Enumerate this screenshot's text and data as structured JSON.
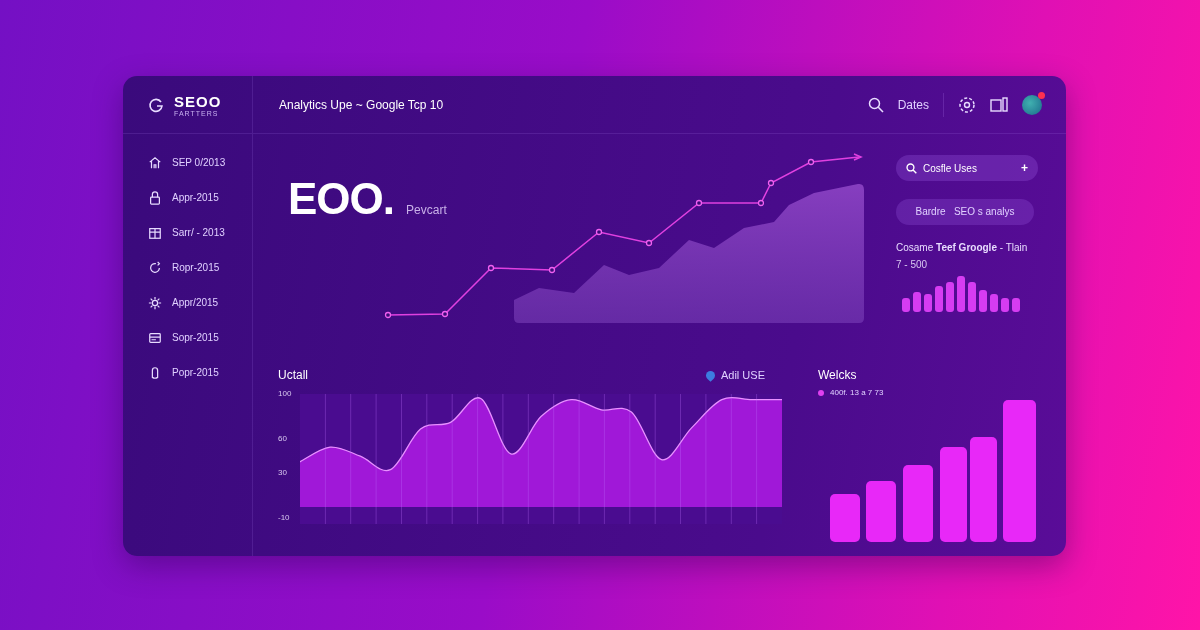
{
  "brand": {
    "name": "SEOO",
    "tagline": "FARTTERS"
  },
  "header": {
    "title": "Analytics Upe ~ Google Tcp 10",
    "dates_label": "Dates",
    "notification": true
  },
  "sidebar": {
    "items": [
      {
        "label": "SEP 0/2013"
      },
      {
        "label": "Appr-2015"
      },
      {
        "label": "Sarr/ - 2013"
      },
      {
        "label": "Ropr-2015"
      },
      {
        "label": "Appr/2015"
      },
      {
        "label": "Sopr-2015"
      },
      {
        "label": "Popr-2015"
      }
    ]
  },
  "hero": {
    "value": "EOO.",
    "caption": "Pevcart"
  },
  "side_panel": {
    "search": {
      "value": "Cosfle Uses",
      "add": "+"
    },
    "pill": "Bardre   SEO s analys",
    "heading": "Cosame **Teef Groogle** - Tlain",
    "range": "7 - 500"
  },
  "usage": {
    "title": "Uctall",
    "legend": {
      "color": "#3d7de0"
    },
    "chart_data": {
      "type": "area",
      "ylim": [
        -15,
        100
      ],
      "yticks": [
        100,
        60,
        30,
        -10
      ],
      "series": [
        {
          "name": "Adil USE",
          "color": "#a018d8",
          "values": [
            40,
            53,
            45,
            33,
            69,
            75,
            96,
            47,
            80,
            95,
            86,
            84,
            42,
            70,
            95,
            95,
            95
          ]
        }
      ]
    }
  },
  "weeks": {
    "title": "Welcks",
    "legend": {
      "label": "400f. 13 a 7 73",
      "color": "#e040f0"
    }
  }
}
